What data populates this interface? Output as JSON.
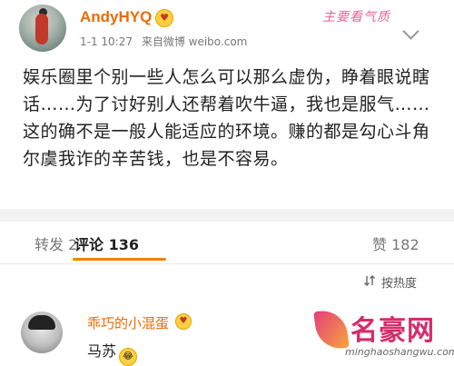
{
  "post": {
    "username": "AndyHYQ",
    "badge_icon": "heart-eyes-emoji-icon",
    "time": "1-1 10:27",
    "source": "来自微博 weibo.com",
    "body": "娱乐圈里个别一些人怎么可以那么虚伪，睁着眼说瞎话……为了讨好别人还帮着吹牛逼，我也是服气…… 这的确不是一般人能适应的环境。赚的都是勾心斗角尔虞我诈的辛苦钱，也是不容易。"
  },
  "watermark_top": "主要看气质",
  "tabs": {
    "repost": "转发 2",
    "comment": "评论 136",
    "like": "赞 182"
  },
  "sort": {
    "label": "按热度",
    "icon": "sort-icon"
  },
  "comment": {
    "username": "乖巧的小混蛋",
    "badge_icon": "heart-eyes-emoji-icon",
    "text": "马苏",
    "emoji": "laughing-tears-emoji-icon"
  },
  "site_logo": {
    "name": "名豪网",
    "url": "minghaoshangwu.com"
  },
  "colors": {
    "username": "#f06a00",
    "tab_underline": "#f08300",
    "logo": "#d62c6b"
  }
}
